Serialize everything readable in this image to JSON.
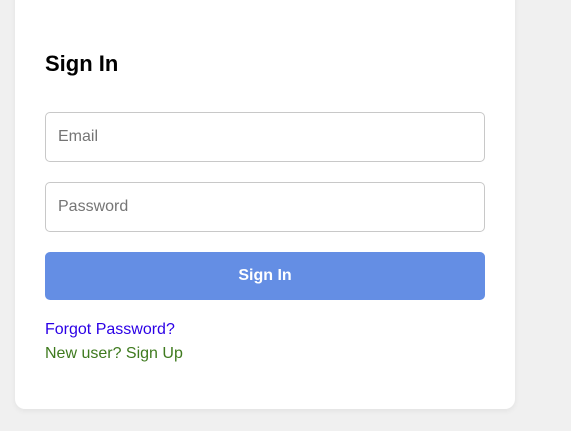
{
  "login": {
    "title": "Sign In",
    "email_placeholder": "Email",
    "email_value": "",
    "password_placeholder": "Password",
    "password_value": "",
    "submit_label": "Sign In",
    "forgot_link": "Forgot Password?",
    "signup_link": "New user? Sign Up"
  },
  "colors": {
    "page_background": "#f0f0f0",
    "card_background": "#ffffff",
    "button_background": "#648ee4",
    "forgot_link": "#2b00e6",
    "signup_link": "#3e7a1e"
  }
}
